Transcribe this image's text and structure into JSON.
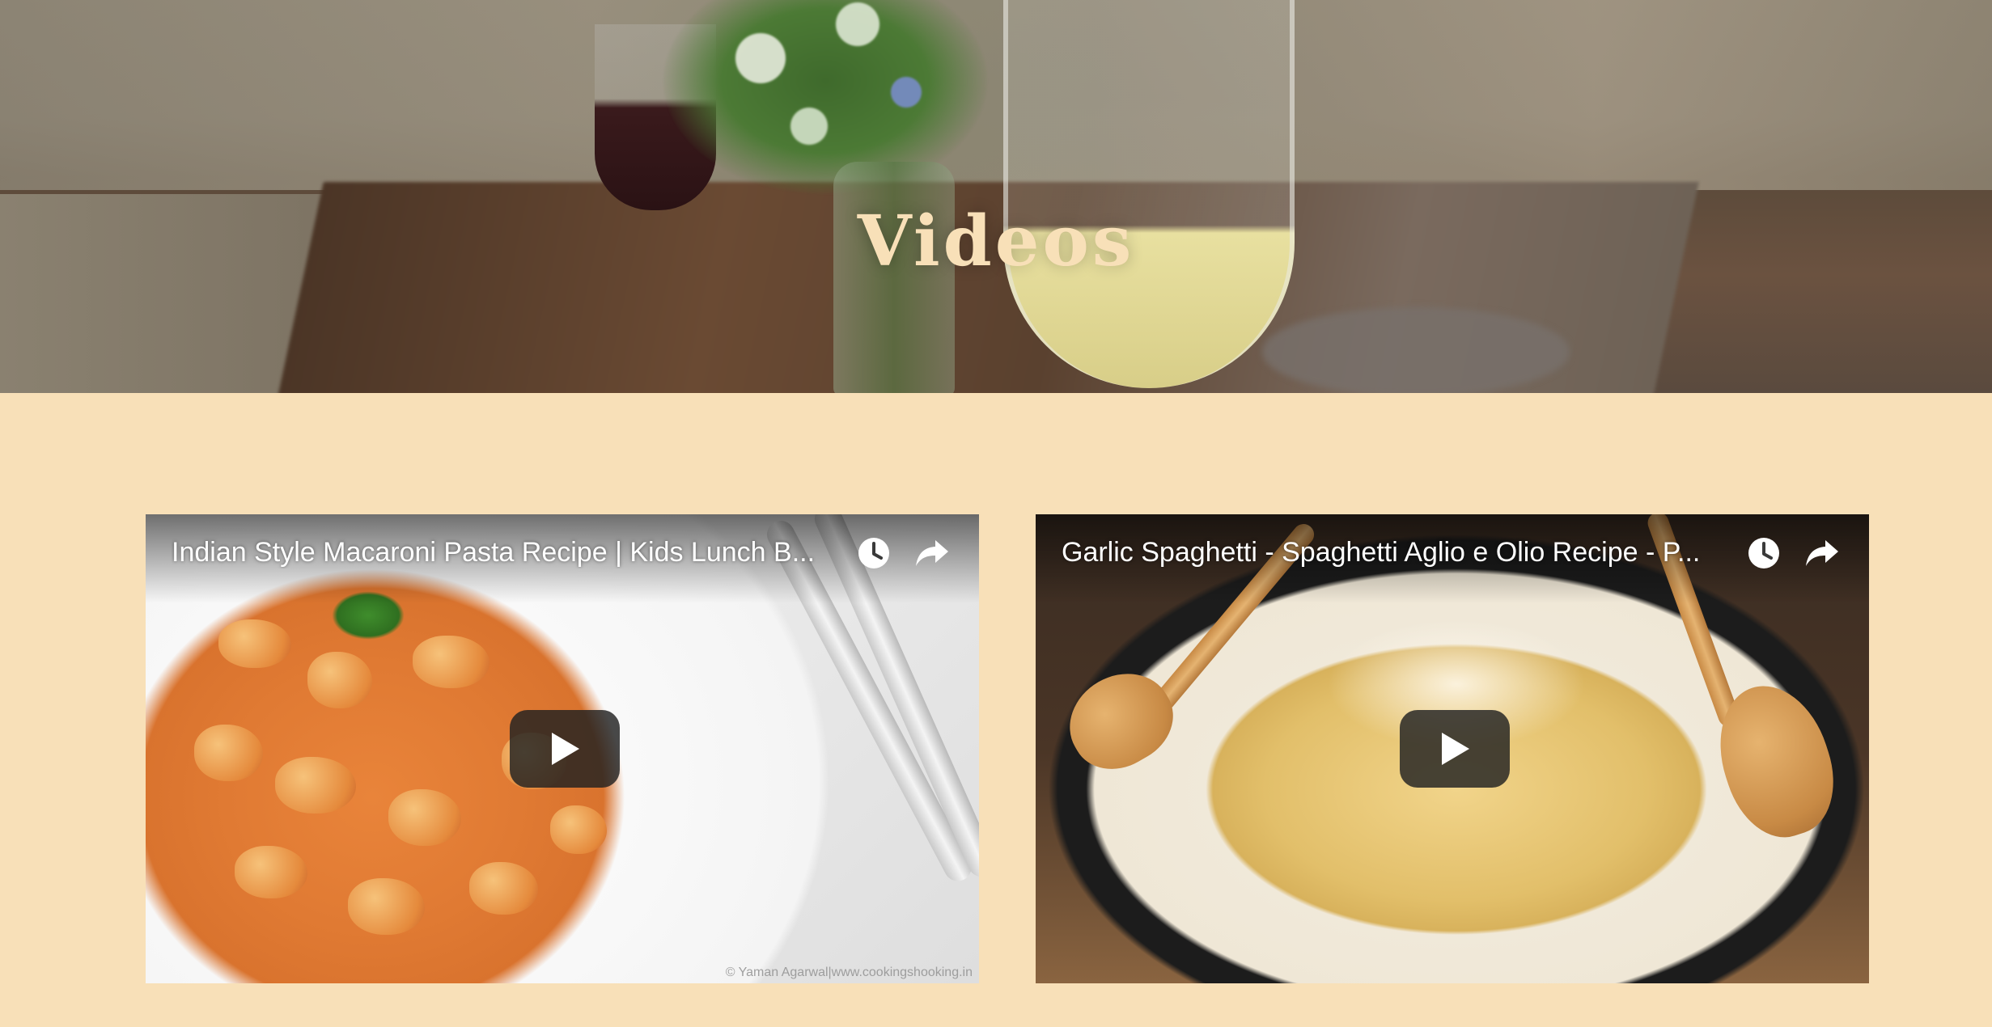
{
  "header": {
    "title": "Videos"
  },
  "videos": [
    {
      "title": "Indian Style Macaroni Pasta Recipe | Kids Lunch B...",
      "watermark": "© Yaman Agarwal|www.cookingshooking.in",
      "watch_later_icon": "clock-icon",
      "share_icon": "share-arrow-icon",
      "play_icon": "play-icon"
    },
    {
      "title": "Garlic Spaghetti - Spaghetti Aglio e Olio Recipe - P...",
      "watch_later_icon": "clock-icon",
      "share_icon": "share-arrow-icon",
      "play_icon": "play-icon"
    }
  ],
  "colors": {
    "page_background": "#f8e0b8",
    "title_color": "#f8e0b8",
    "play_button_bg": "#212121"
  }
}
